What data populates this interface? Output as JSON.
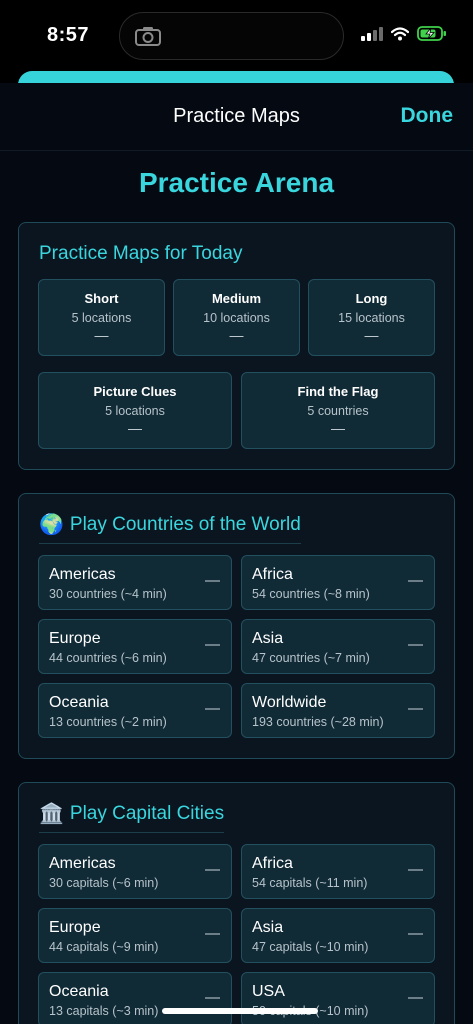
{
  "status": {
    "time": "8:57"
  },
  "nav": {
    "title": "Practice Maps",
    "done_label": "Done"
  },
  "arena_title": "Practice Arena",
  "today": {
    "title": "Practice Maps for Today",
    "tiles": [
      {
        "label": "Short",
        "sub": "5 locations",
        "status": "—"
      },
      {
        "label": "Medium",
        "sub": "10 locations",
        "status": "—"
      },
      {
        "label": "Long",
        "sub": "15 locations",
        "status": "—"
      },
      {
        "label": "Picture Clues",
        "sub": "5 locations",
        "status": "—"
      },
      {
        "label": "Find the Flag",
        "sub": "5 countries",
        "status": "—"
      }
    ]
  },
  "countries": {
    "emoji": "🌍",
    "title": "Play Countries of the World",
    "tiles": [
      {
        "label": "Americas",
        "sub": "30 countries (~4 min)",
        "status": "—"
      },
      {
        "label": "Africa",
        "sub": "54 countries (~8 min)",
        "status": "—"
      },
      {
        "label": "Europe",
        "sub": "44 countries (~6 min)",
        "status": "—"
      },
      {
        "label": "Asia",
        "sub": "47 countries (~7 min)",
        "status": "—"
      },
      {
        "label": "Oceania",
        "sub": "13 countries (~2 min)",
        "status": "—"
      },
      {
        "label": "Worldwide",
        "sub": "193 countries (~28 min)",
        "status": "—"
      }
    ]
  },
  "capitals": {
    "emoji": "🏛️",
    "title": "Play Capital Cities",
    "tiles": [
      {
        "label": "Americas",
        "sub": "30 capitals (~6 min)",
        "status": "—"
      },
      {
        "label": "Africa",
        "sub": "54 capitals (~11 min)",
        "status": "—"
      },
      {
        "label": "Europe",
        "sub": "44 capitals (~9 min)",
        "status": "—"
      },
      {
        "label": "Asia",
        "sub": "47 capitals (~10 min)",
        "status": "—"
      },
      {
        "label": "Oceania",
        "sub": "13 capitals (~3 min)",
        "status": "—"
      },
      {
        "label": "USA",
        "sub": "50 capitals (~10 min)",
        "status": "—"
      }
    ]
  }
}
